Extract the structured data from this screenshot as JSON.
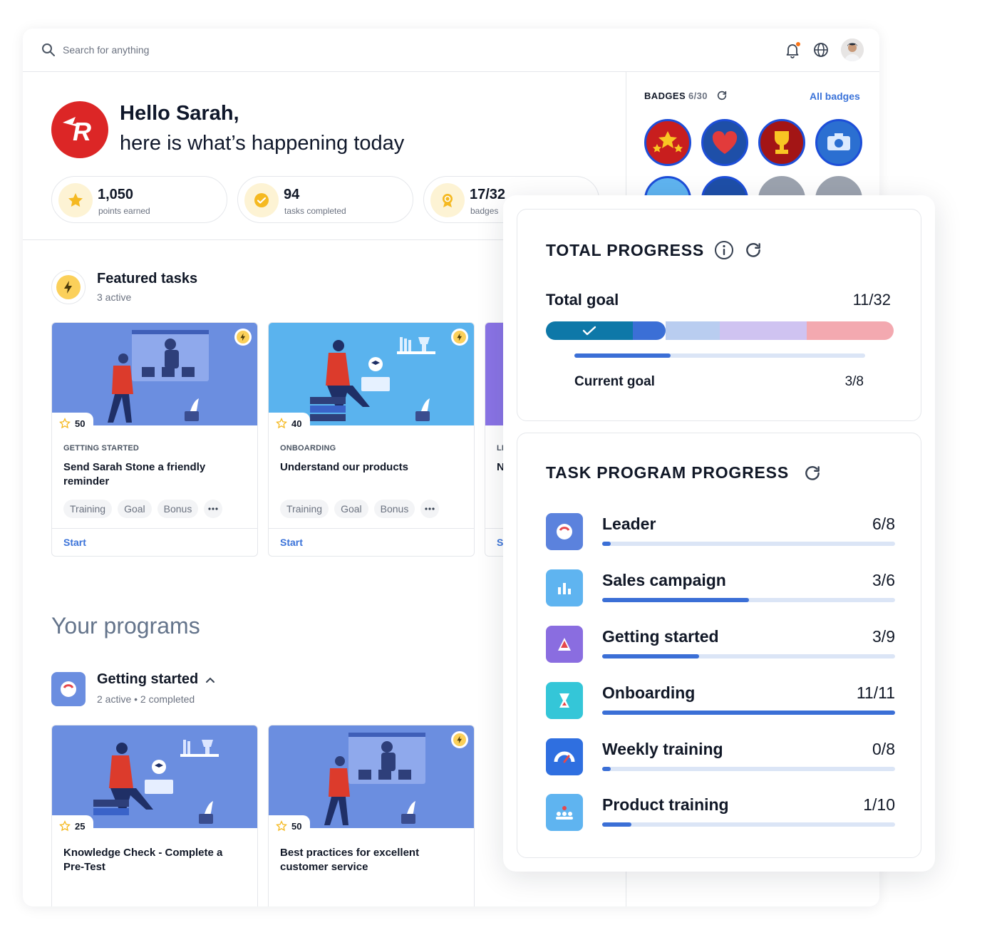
{
  "search": {
    "placeholder": "Search for anything"
  },
  "greeting": {
    "title": "Hello Sarah,",
    "subtitle": "here is what’s happening today"
  },
  "stats": [
    {
      "value": "1,050",
      "label": "points earned",
      "icon": "star-icon"
    },
    {
      "value": "94",
      "label": "tasks completed",
      "icon": "check-circle-icon"
    },
    {
      "value": "17/32",
      "label": "badges",
      "icon": "medal-icon"
    }
  ],
  "featured": {
    "title": "Featured tasks",
    "subtitle": "3 active"
  },
  "featured_cards": [
    {
      "points": "50",
      "category": "GETTING STARTED",
      "title": "Send Sarah Stone a friendly reminder",
      "tags": [
        "Training",
        "Goal",
        "Bonus"
      ],
      "action": "Start"
    },
    {
      "points": "40",
      "category": "ONBOARDING",
      "title": "Understand our products",
      "tags": [
        "Training",
        "Goal",
        "Bonus"
      ],
      "action": "Start"
    },
    {
      "category": "LI",
      "title": "N",
      "action": "S"
    }
  ],
  "programs": {
    "title": "Your programs",
    "group_title": "Getting started",
    "group_sub": "2 active • 2 completed",
    "cards": [
      {
        "points": "25",
        "title": "Knowledge Check - Complete a Pre-Test"
      },
      {
        "points": "50",
        "title": "Best practices for excellent customer service"
      }
    ]
  },
  "badges": {
    "label": "BADGES",
    "count": "6/30",
    "link": "All badges",
    "items": [
      {
        "name": "stars-badge",
        "color": "#c81e1e"
      },
      {
        "name": "heart-badge",
        "color": "#1e4fa8"
      },
      {
        "name": "trophy-badge",
        "color": "#a31515"
      },
      {
        "name": "camera-badge",
        "color": "#2b6fd1"
      }
    ]
  },
  "total_progress": {
    "title": "TOTAL PROGRESS",
    "goal_label": "Total goal",
    "goal_value": "11/32",
    "current_label": "Current goal",
    "current_value": "3/8",
    "current_fraction": 0.33
  },
  "task_program": {
    "title": "TASK PROGRAM PROGRESS",
    "rows": [
      {
        "name": "Leader",
        "value": "6/8",
        "fraction": 0.03,
        "color": "#5b82dd"
      },
      {
        "name": "Sales campaign",
        "value": "3/6",
        "fraction": 0.5,
        "color": "#5fb4f0"
      },
      {
        "name": "Getting started",
        "value": "3/9",
        "fraction": 0.33,
        "color": "#8a6de0"
      },
      {
        "name": "Onboarding",
        "value": "11/11",
        "fraction": 1.0,
        "color": "#34c6d8"
      },
      {
        "name": "Weekly training",
        "value": "0/8",
        "fraction": 0.03,
        "color": "#2f6fe0"
      },
      {
        "name": "Product training",
        "value": "1/10",
        "fraction": 0.1,
        "color": "#5fb4f0"
      }
    ]
  },
  "colors": {
    "accent": "#3b73d9",
    "brand_red": "#dc2626",
    "progress_fill": "#3b6fd6"
  }
}
